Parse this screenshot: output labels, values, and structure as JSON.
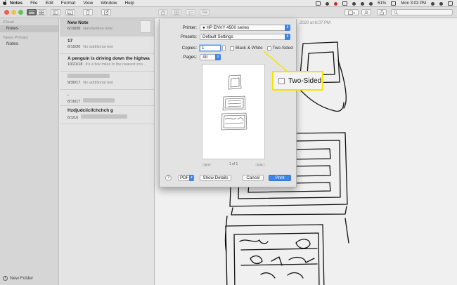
{
  "menubar": {
    "apple": "",
    "items": [
      "Notes",
      "File",
      "Edit",
      "Format",
      "View",
      "Window",
      "Help"
    ],
    "battery": "61%",
    "clock": "Mon 3:03 PM"
  },
  "sidebar": {
    "accounts": [
      {
        "name": "iCloud",
        "folders": [
          {
            "label": "Notes",
            "selected": true
          }
        ]
      },
      {
        "name": "Yahoo Primary",
        "folders": [
          {
            "label": "Notes",
            "selected": false
          }
        ]
      }
    ],
    "new_folder": "New Folder"
  },
  "notes": [
    {
      "title": "New Note",
      "date": "6/19/20",
      "preview": "Handwritten note",
      "selected": true
    },
    {
      "title": "17",
      "date": "6/15/20",
      "preview": "No additional text",
      "selected": false
    },
    {
      "title": "A penguin is driving down the highwa...",
      "date": "10/21/18",
      "preview": "It's a few miles to the nearest zoo...",
      "selected": false
    },
    {
      "title": "",
      "date": "9/30/17",
      "preview": "No additional text",
      "selected": false
    },
    {
      "title": ".",
      "date": "8/16/17",
      "preview": "",
      "selected": false
    },
    {
      "title": "Hzdjudciicifchchch g",
      "date": "6/1/16",
      "preview": "",
      "selected": false
    }
  ],
  "editor": {
    "date_fragment": "2020 at 6:07 PM"
  },
  "print_dialog": {
    "printer_label": "Printer:",
    "printer_value": "HP ENVY 4500 series",
    "presets_label": "Presets:",
    "presets_value": "Default Settings",
    "copies_label": "Copies:",
    "copies_value": "1",
    "bw_label": "Black & White",
    "two_sided_label": "Two-Sided",
    "pages_label": "Pages:",
    "pages_value": "All",
    "page_counter": "1 of 1",
    "help": "?",
    "pdf": "PDF",
    "show_details": "Show Details",
    "cancel": "Cancel",
    "print": "Print"
  },
  "callout": {
    "label": "Two-Sided",
    "color": "#f2e600"
  },
  "colors": {
    "accent": "#3f84e6",
    "close": "#ec5f57",
    "minimize": "#f4bf4f",
    "zoom": "#5ec454"
  }
}
